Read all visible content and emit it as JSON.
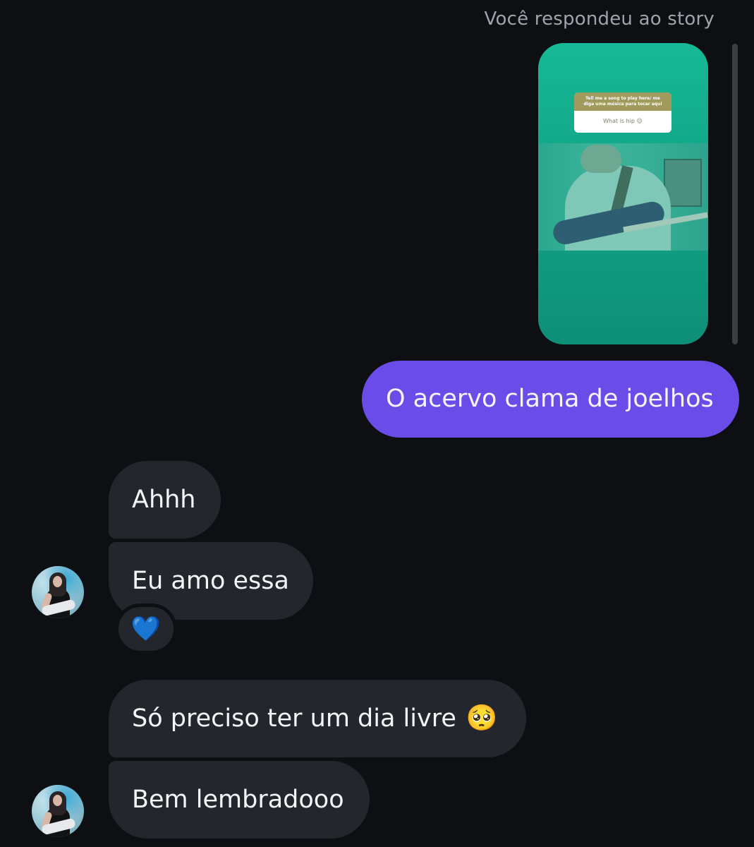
{
  "header": {
    "story_reply_caption": "Você respondeu ao story"
  },
  "story": {
    "question_text": "Tell me a song to play here/ me diga uma música para tocar aqui",
    "answer_text": "What is hip 😉"
  },
  "messages": {
    "outgoing_1": "O acervo clama de joelhos",
    "incoming_1": "Ahhh",
    "incoming_2": "Eu amo essa",
    "incoming_3": "Só preciso ter um dia livre",
    "incoming_3_emoji": "🥺",
    "incoming_4": "Bem lembradooo"
  },
  "reaction": {
    "emoji": "💙"
  },
  "colors": {
    "background": "#0d0f13",
    "outgoing_bubble": "#6a4de8",
    "incoming_bubble": "#23262c",
    "story_gradient_top": "#16b996",
    "story_gradient_bottom": "#0e8f77"
  }
}
